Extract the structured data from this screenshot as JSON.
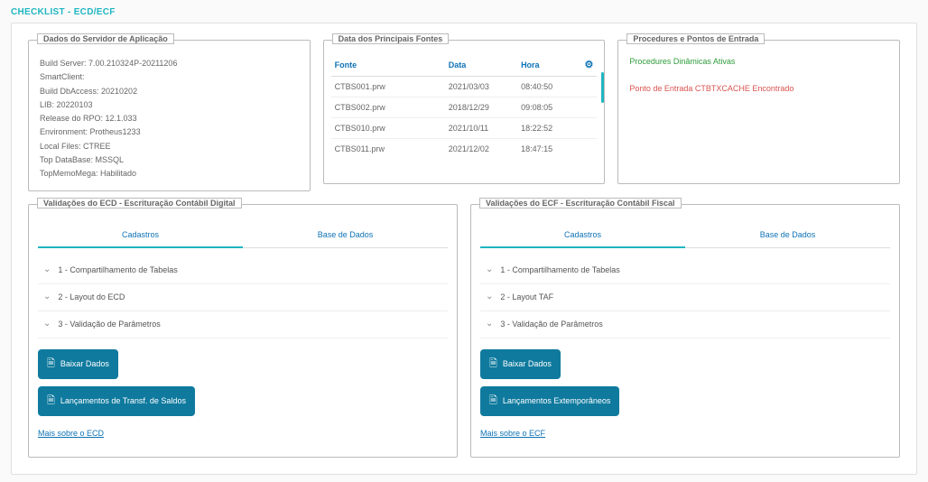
{
  "page": {
    "title": "CHECKLIST - ECD/ECF"
  },
  "server_panel": {
    "heading": "Dados do Servidor de Aplicação",
    "lines": {
      "build_server": "Build Server: 7.00.210324P-20211206",
      "smartclient": "SmartClient:",
      "dbaccess": "Build DbAccess: 20210202",
      "lib": "LIB: 20220103",
      "rpo": "Release do RPO: 12.1.033",
      "env": "Environment: Protheus1233",
      "local_files": "Local Files: CTREE",
      "top_db": "Top DataBase: MSSQL",
      "memo": "TopMemoMega: Habilitado"
    }
  },
  "fontes_panel": {
    "heading": "Data dos Principais Fontes",
    "headers": {
      "fonte": "Fonte",
      "data": "Data",
      "hora": "Hora"
    },
    "rows": [
      {
        "fonte": "CTBS001.prw",
        "data": "2021/03/03",
        "hora": "08:40:50"
      },
      {
        "fonte": "CTBS002.prw",
        "data": "2018/12/29",
        "hora": "09:08:05"
      },
      {
        "fonte": "CTBS010.prw",
        "data": "2021/10/11",
        "hora": "18:22:52"
      },
      {
        "fonte": "CTBS011.prw",
        "data": "2021/12/02",
        "hora": "18:47:15"
      }
    ]
  },
  "procedures_panel": {
    "heading": "Procedures e Pontos de Entrada",
    "ok": "Procedures Dinâmicas Ativas",
    "err": "Ponto de Entrada CTBTXCACHE Encontrado"
  },
  "ecd": {
    "heading": "Validações do ECD - Escrituração Contábil Digital",
    "tabs": {
      "cadastros": "Cadastros",
      "base": "Base de Dados"
    },
    "items": {
      "i1": "1 - Compartilhamento de Tabelas",
      "i2": "2 - Layout do ECD",
      "i3": "3 - Validação de Parâmetros"
    },
    "btn1": "Baixar Dados",
    "btn2": "Lançamentos de Transf. de Saldos",
    "more": "Mais sobre o ECD"
  },
  "ecf": {
    "heading": "Validações do ECF - Escrituração Contábil Fiscal",
    "tabs": {
      "cadastros": "Cadastros",
      "base": "Base de Dados"
    },
    "items": {
      "i1": "1 - Compartilhamento de Tabelas",
      "i2": "2 - Layout TAF",
      "i3": "3 - Validação de Parâmetros"
    },
    "btn1": "Baixar Dados",
    "btn2": "Lançamentos Extemporâneos",
    "more": "Mais sobre o ECF"
  },
  "colors": {
    "accent": "#1fb6c1",
    "btn": "#0f7a9e",
    "link": "#0e72b5"
  }
}
